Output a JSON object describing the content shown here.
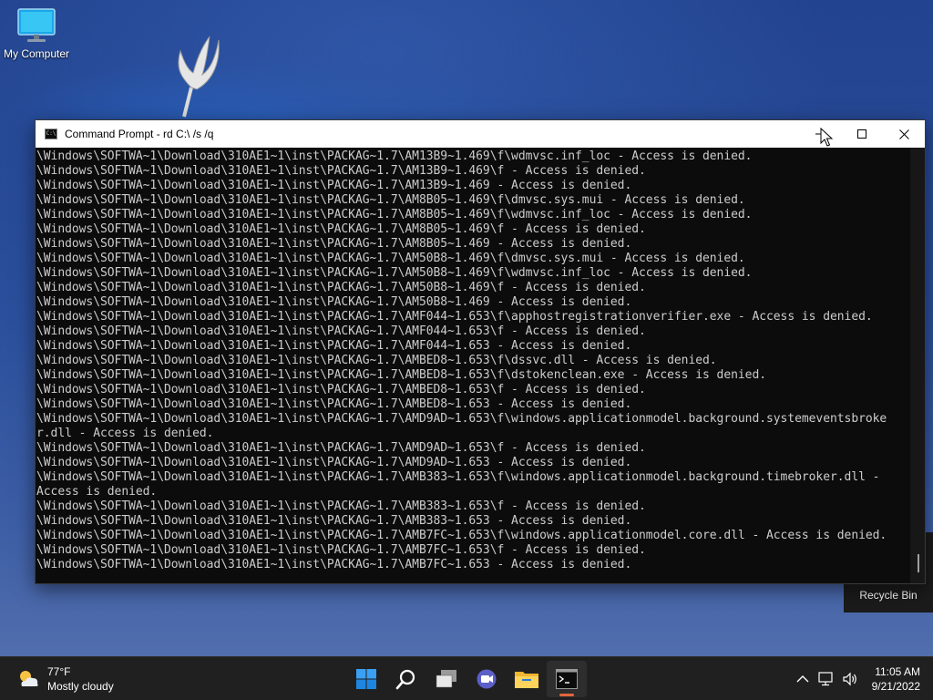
{
  "desktop": {
    "icons": [
      {
        "label": "My Computer"
      },
      {
        "label": "Recycle Bin"
      }
    ]
  },
  "window": {
    "title": "Command Prompt - rd  C:\\ /s /q",
    "buttons": [
      "minimize",
      "maximize",
      "close"
    ]
  },
  "console": {
    "lines": [
      "\\Windows\\SOFTWA~1\\Download\\310AE1~1\\inst\\PACKAG~1.7\\AM13B9~1.469\\f\\wdmvsc.inf_loc - Access is denied.",
      "\\Windows\\SOFTWA~1\\Download\\310AE1~1\\inst\\PACKAG~1.7\\AM13B9~1.469\\f - Access is denied.",
      "\\Windows\\SOFTWA~1\\Download\\310AE1~1\\inst\\PACKAG~1.7\\AM13B9~1.469 - Access is denied.",
      "\\Windows\\SOFTWA~1\\Download\\310AE1~1\\inst\\PACKAG~1.7\\AM8B05~1.469\\f\\dmvsc.sys.mui - Access is denied.",
      "\\Windows\\SOFTWA~1\\Download\\310AE1~1\\inst\\PACKAG~1.7\\AM8B05~1.469\\f\\wdmvsc.inf_loc - Access is denied.",
      "\\Windows\\SOFTWA~1\\Download\\310AE1~1\\inst\\PACKAG~1.7\\AM8B05~1.469\\f - Access is denied.",
      "\\Windows\\SOFTWA~1\\Download\\310AE1~1\\inst\\PACKAG~1.7\\AM8B05~1.469 - Access is denied.",
      "\\Windows\\SOFTWA~1\\Download\\310AE1~1\\inst\\PACKAG~1.7\\AM50B8~1.469\\f\\dmvsc.sys.mui - Access is denied.",
      "\\Windows\\SOFTWA~1\\Download\\310AE1~1\\inst\\PACKAG~1.7\\AM50B8~1.469\\f\\wdmvsc.inf_loc - Access is denied.",
      "\\Windows\\SOFTWA~1\\Download\\310AE1~1\\inst\\PACKAG~1.7\\AM50B8~1.469\\f - Access is denied.",
      "\\Windows\\SOFTWA~1\\Download\\310AE1~1\\inst\\PACKAG~1.7\\AM50B8~1.469 - Access is denied.",
      "\\Windows\\SOFTWA~1\\Download\\310AE1~1\\inst\\PACKAG~1.7\\AMF044~1.653\\f\\apphostregistrationverifier.exe - Access is denied.",
      "\\Windows\\SOFTWA~1\\Download\\310AE1~1\\inst\\PACKAG~1.7\\AMF044~1.653\\f - Access is denied.",
      "\\Windows\\SOFTWA~1\\Download\\310AE1~1\\inst\\PACKAG~1.7\\AMF044~1.653 - Access is denied.",
      "\\Windows\\SOFTWA~1\\Download\\310AE1~1\\inst\\PACKAG~1.7\\AMBED8~1.653\\f\\dssvc.dll - Access is denied.",
      "\\Windows\\SOFTWA~1\\Download\\310AE1~1\\inst\\PACKAG~1.7\\AMBED8~1.653\\f\\dstokenclean.exe - Access is denied.",
      "\\Windows\\SOFTWA~1\\Download\\310AE1~1\\inst\\PACKAG~1.7\\AMBED8~1.653\\f - Access is denied.",
      "\\Windows\\SOFTWA~1\\Download\\310AE1~1\\inst\\PACKAG~1.7\\AMBED8~1.653 - Access is denied.",
      "\\Windows\\SOFTWA~1\\Download\\310AE1~1\\inst\\PACKAG~1.7\\AMD9AD~1.653\\f\\windows.applicationmodel.background.systemeventsbroke",
      "r.dll - Access is denied.",
      "\\Windows\\SOFTWA~1\\Download\\310AE1~1\\inst\\PACKAG~1.7\\AMD9AD~1.653\\f - Access is denied.",
      "\\Windows\\SOFTWA~1\\Download\\310AE1~1\\inst\\PACKAG~1.7\\AMD9AD~1.653 - Access is denied.",
      "\\Windows\\SOFTWA~1\\Download\\310AE1~1\\inst\\PACKAG~1.7\\AMB383~1.653\\f\\windows.applicationmodel.background.timebroker.dll -",
      "Access is denied.",
      "\\Windows\\SOFTWA~1\\Download\\310AE1~1\\inst\\PACKAG~1.7\\AMB383~1.653\\f - Access is denied.",
      "\\Windows\\SOFTWA~1\\Download\\310AE1~1\\inst\\PACKAG~1.7\\AMB383~1.653 - Access is denied.",
      "\\Windows\\SOFTWA~1\\Download\\310AE1~1\\inst\\PACKAG~1.7\\AMB7FC~1.653\\f\\windows.applicationmodel.core.dll - Access is denied.",
      "\\Windows\\SOFTWA~1\\Download\\310AE1~1\\inst\\PACKAG~1.7\\AMB7FC~1.653\\f - Access is denied.",
      "\\Windows\\SOFTWA~1\\Download\\310AE1~1\\inst\\PACKAG~1.7\\AMB7FC~1.653 - Access is denied."
    ]
  },
  "taskbar": {
    "weather": {
      "temp": "77°F",
      "condition": "Mostly cloudy",
      "icon": "partly-cloudy-icon"
    },
    "apps": [
      "start-icon",
      "search-icon",
      "task-view-icon",
      "teams-chat-icon",
      "file-explorer-icon",
      "command-prompt-icon"
    ],
    "tray_icons": [
      "chevron-up-icon",
      "network-icon",
      "volume-icon"
    ],
    "time": "11:05 AM",
    "date": "9/21/2022",
    "accent": "#e0663c"
  }
}
